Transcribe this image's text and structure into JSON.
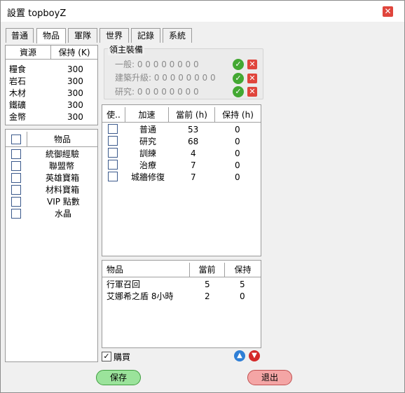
{
  "window": {
    "title": "設置 topboyZ"
  },
  "tabs": [
    "普通",
    "物品",
    "軍隊",
    "世界",
    "記錄",
    "系統"
  ],
  "resources": {
    "headers": [
      "資源",
      "保持 (K)"
    ],
    "rows": [
      {
        "name": "糧食",
        "keep": "300"
      },
      {
        "name": "岩石",
        "keep": "300"
      },
      {
        "name": "木材",
        "keep": "300"
      },
      {
        "name": "鐵礦",
        "keep": "300"
      },
      {
        "name": "金幣",
        "keep": "300"
      }
    ]
  },
  "items": {
    "header": "物品",
    "rows": [
      "統御經驗",
      "聯盟幣",
      "英雄寶箱",
      "材料寶箱",
      "VIP 點數",
      "水晶"
    ]
  },
  "lord_equip": {
    "title": "領主裝備",
    "rows": [
      {
        "label": "一般: 0 0 0 0 0 0 0 0"
      },
      {
        "label": "建築升級: 0 0 0 0 0 0 0 0"
      },
      {
        "label": "研究: 0 0 0 0 0 0 0 0"
      }
    ]
  },
  "speedups": {
    "headers": [
      "使..",
      "加速",
      "當前 (h)",
      "保持 (h)"
    ],
    "rows": [
      {
        "name": "普通",
        "current": "53",
        "keep": "0"
      },
      {
        "name": "研究",
        "current": "68",
        "keep": "0"
      },
      {
        "name": "訓練",
        "current": "4",
        "keep": "0"
      },
      {
        "name": "治療",
        "current": "7",
        "keep": "0"
      },
      {
        "name": "城牆修復",
        "current": "7",
        "keep": "0"
      }
    ]
  },
  "item_keep": {
    "headers": [
      "物品",
      "當前",
      "保持"
    ],
    "rows": [
      {
        "name": "行軍召回",
        "current": "5",
        "keep": "5"
      },
      {
        "name": "艾娜希之盾 8小時",
        "current": "2",
        "keep": "0"
      }
    ]
  },
  "buy": {
    "label": "購買",
    "checked": true
  },
  "buttons": {
    "save": "保存",
    "exit": "退出"
  },
  "colors": {
    "ok": "#43a832",
    "cancel": "#e0453c",
    "save_btn": "#9be39b",
    "exit_btn": "#f4a5a5"
  }
}
